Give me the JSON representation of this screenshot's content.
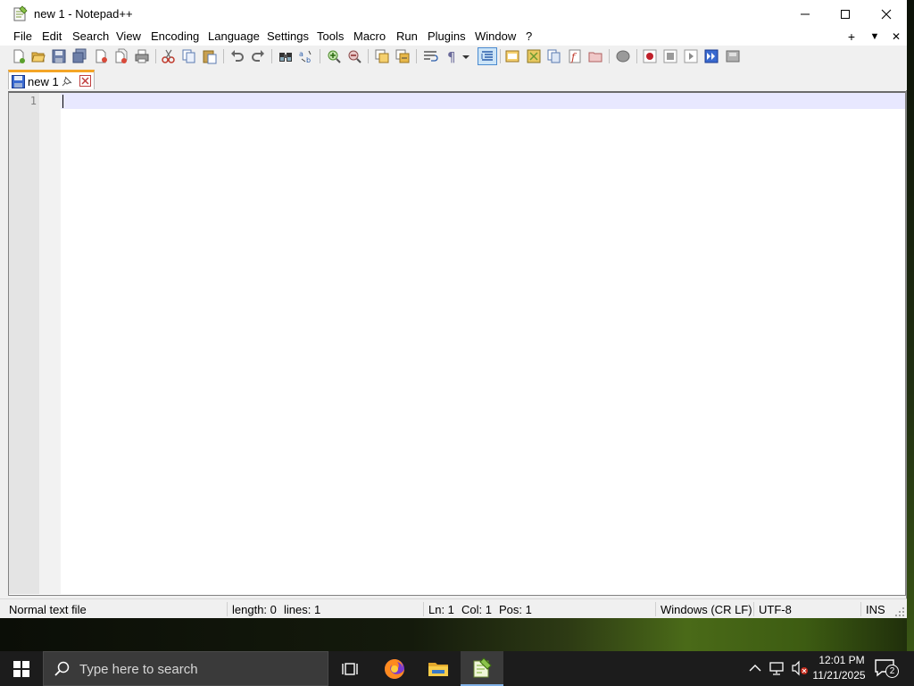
{
  "window": {
    "title": "new 1 - Notepad++"
  },
  "menu": {
    "items": [
      "File",
      "Edit",
      "Search",
      "View",
      "Encoding",
      "Language",
      "Settings",
      "Tools",
      "Macro",
      "Run",
      "Plugins",
      "Window",
      "?"
    ],
    "right": [
      "+",
      "▼",
      "✕"
    ]
  },
  "toolbar": {
    "icons": [
      "new-file-icon",
      "open-file-icon",
      "save-icon",
      "save-all-icon",
      "close-icon",
      "close-all-icon",
      "print-icon",
      "cut-icon",
      "copy-icon",
      "paste-icon",
      "undo-icon",
      "redo-icon",
      "find-icon",
      "replace-icon",
      "zoom-in-icon",
      "zoom-out-icon",
      "sync-vertical-icon",
      "sync-horizontal-icon",
      "word-wrap-icon",
      "show-all-characters-icon",
      "indent-guide-icon",
      "udl-icon",
      "doc-map-icon",
      "document-list-icon",
      "function-list-icon",
      "folder-as-workspace-icon",
      "monitoring-icon",
      "record-macro-icon",
      "stop-recording-icon",
      "play-macro-icon",
      "run-macro-multiple-icon",
      "save-macro-icon"
    ]
  },
  "tabs": [
    {
      "label": "new 1",
      "active": true
    }
  ],
  "editor": {
    "line_numbers": [
      "1"
    ],
    "content": ""
  },
  "status": {
    "file_type": "Normal text file",
    "length": "length: 0",
    "lines": "lines: 1",
    "ln": "Ln: 1",
    "col": "Col: 1",
    "pos": "Pos: 1",
    "eol": "Windows (CR LF)",
    "encoding": "UTF-8",
    "mode": "INS"
  },
  "taskbar": {
    "search_placeholder": "Type here to search",
    "time": "12:01 PM",
    "date": "11/21/2025",
    "notification_count": "2",
    "colors": {
      "background": "#1c1c1c",
      "active_indicator": "#7fb0e6"
    }
  },
  "colors": {
    "tab_accent": "#f4a526",
    "current_line": "#e8e8ff",
    "gutter": "#e4e4e4"
  }
}
